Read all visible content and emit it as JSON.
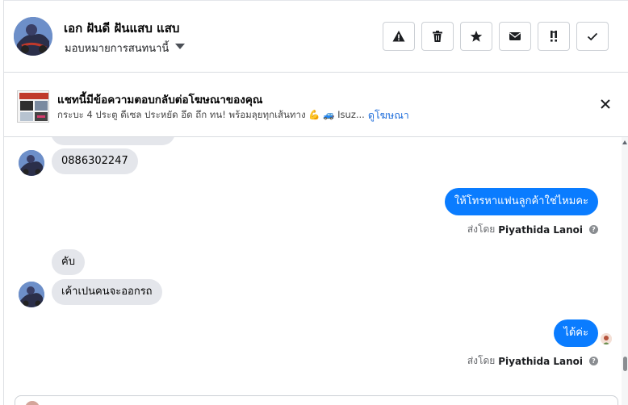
{
  "contact": {
    "name": "เอก ฝันดี ฝันแสบ แสบ",
    "assign_label": "มอบหมายการสนทนานี้"
  },
  "actions": [
    {
      "name": "report-spam-icon"
    },
    {
      "name": "trash-icon"
    },
    {
      "name": "star-icon"
    },
    {
      "name": "envelope-icon"
    },
    {
      "name": "follow-up-icon"
    },
    {
      "name": "checkmark-icon"
    }
  ],
  "ad_banner": {
    "title": "แชทนี้มีข้อความตอบกลับต่อโฆษณาของคุณ",
    "subtitle": "กระบะ 4 ประตู ดีเซล ประหยัด อึด ถึก ทน! พร้อมลุยทุกเส้นทาง 💪 🚙 Isuz...",
    "link": "ดูโฆษณา"
  },
  "messages": [
    {
      "from": "customer",
      "text": "0886302247"
    },
    {
      "from": "page",
      "text": "ให้โทรหาแฟนลูกค้าใช่ไหมคะ"
    },
    {
      "from": "customer",
      "text": "คับ"
    },
    {
      "from": "customer",
      "text": "เค้าเปนคนจะออกรถ"
    },
    {
      "from": "page",
      "text": "ได้ค่ะ"
    }
  ],
  "sent_by": {
    "prefix": "ส่งโดย",
    "agent": "Piyathida Lanoi"
  },
  "colors": {
    "outgoing_bubble": "#0a7cff",
    "incoming_bubble": "#e4e6eb",
    "link": "#216fdb"
  }
}
